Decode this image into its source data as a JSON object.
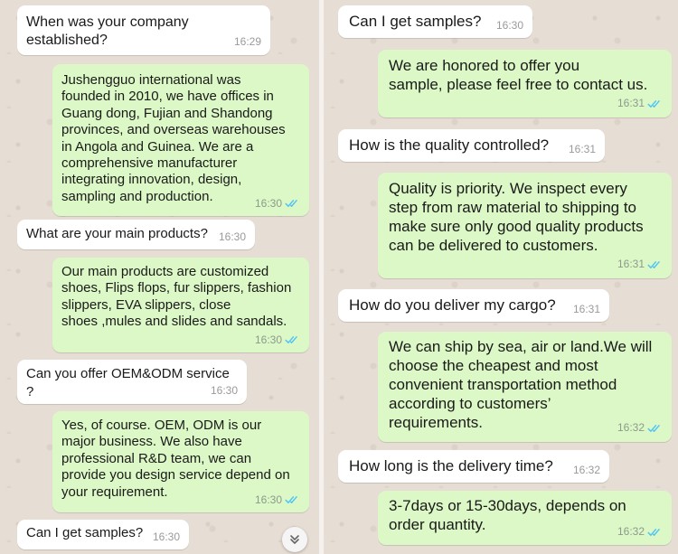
{
  "left_chat": {
    "messages": [
      {
        "text": "When was your company established?",
        "time": "16:29"
      },
      {
        "text": "Jushengguo international was\nfounded in 2010, we have offices in\nGuang dong, Fujian and Shandong\nprovinces, and overseas warehouses\nin Angola and Guinea. We are a\ncomprehensive manufacturer\nintegrating innovation, design,\nsampling and production.",
        "time": "16:30"
      },
      {
        "text": "What are your main products?",
        "time": "16:30"
      },
      {
        "text": "Our main products are customized\nshoes, Flips flops, fur slippers, fashion\nslippers, EVA slippers, close\nshoes ,mules and slides and sandals.",
        "time": "16:30"
      },
      {
        "text": "Can you offer OEM&ODM service ?",
        "time": "16:30"
      },
      {
        "text": "Yes, of course. OEM, ODM is our\nmajor business. We also have\nprofessional R&D team, we can\nprovide you design service depend on\nyour requirement.",
        "time": "16:30"
      },
      {
        "text": "Can I get samples?",
        "time": "16:30"
      }
    ]
  },
  "right_chat": {
    "messages": [
      {
        "text": "Can I get samples?",
        "time": "16:30"
      },
      {
        "text": "We are honored to offer you\nsample, please feel free to contact us.",
        "time": "16:31"
      },
      {
        "text": "How is the quality controlled?",
        "time": "16:31"
      },
      {
        "text": "Quality is priority. We inspect every\nstep from raw material to shipping to\nmake sure only good quality products\ncan be delivered to customers.",
        "time": "16:31"
      },
      {
        "text": "How do you deliver my cargo?",
        "time": "16:31"
      },
      {
        "text": "We can ship by sea, air or land.We will\nchoose the cheapest and most\nconvenient transportation method\naccording to customers’\nrequirements.",
        "time": "16:32"
      },
      {
        "text": "How long is the delivery time?",
        "time": "16:32"
      },
      {
        "text": "3-7days or 15-30days, depends on\norder quantity.",
        "time": "16:32"
      }
    ]
  },
  "colors": {
    "incoming_bubble": "#ffffff",
    "outgoing_bubble": "#dcf8c6",
    "read_ticks": "#4fc3f7",
    "wallpaper": "#e6ddd4"
  }
}
